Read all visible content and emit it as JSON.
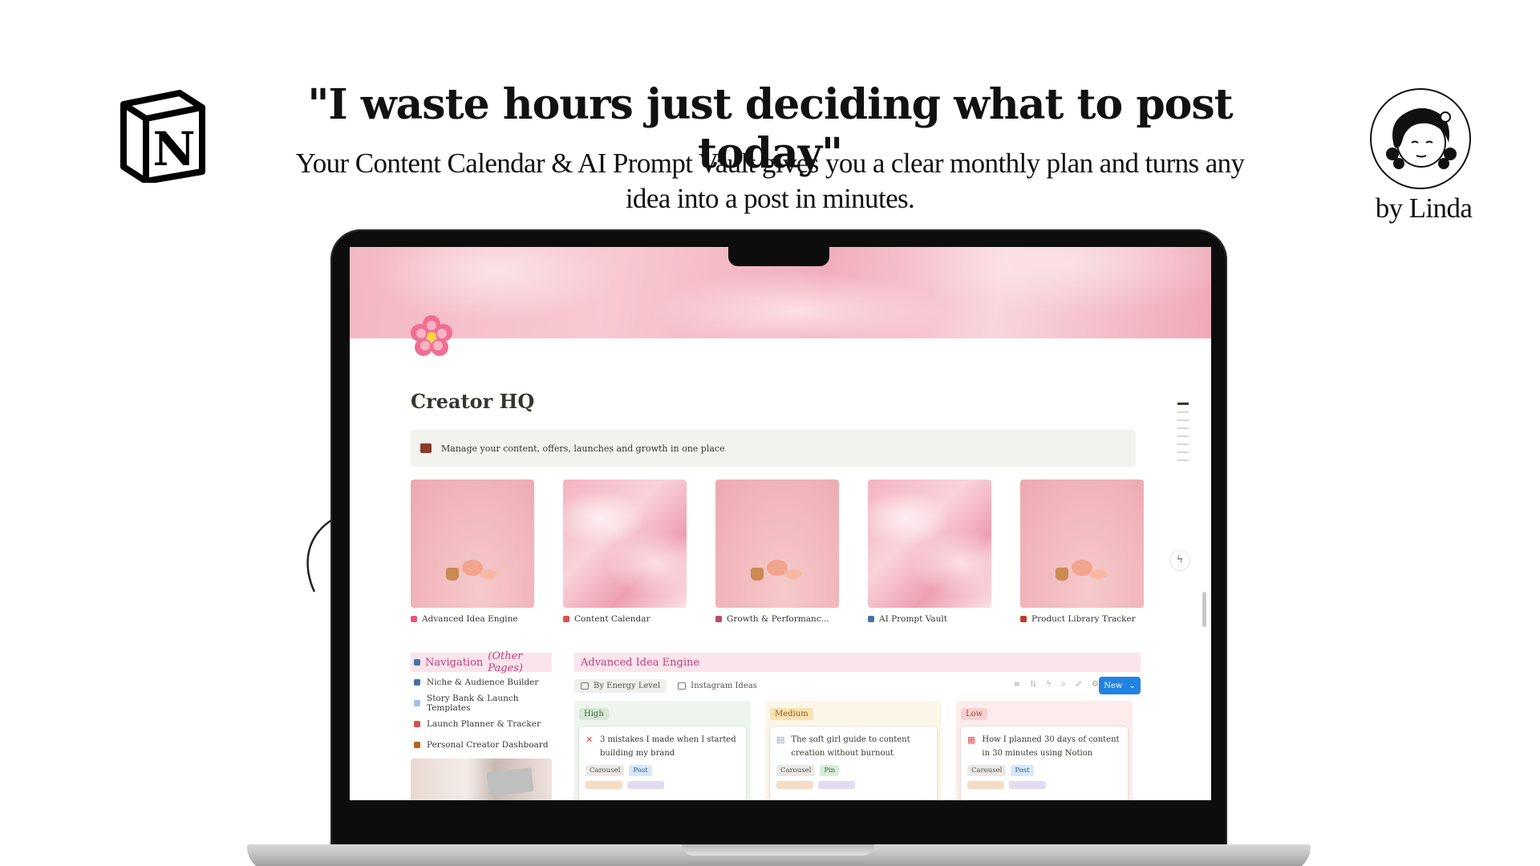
{
  "promo": {
    "headline": "\"I waste hours just deciding what to post today\"",
    "subline": "Your Content Calendar & AI Prompt Vault gives you a clear monthly plan and turns any idea into a post in minutes.",
    "byline": "by Linda"
  },
  "notion_page": {
    "title": "Creator HQ",
    "callout": "Manage your content, offers, launches and growth in one place",
    "gallery": [
      {
        "label": "Advanced Idea Engine",
        "icon_color": "#e8587a",
        "thumb": "still"
      },
      {
        "label": "Content Calendar",
        "icon_color": "#d9534f",
        "thumb": "silk"
      },
      {
        "label": "Growth & Performanc...",
        "icon_color": "#b94a6a",
        "thumb": "still"
      },
      {
        "label": "AI Prompt Vault",
        "icon_color": "#4a6fa5",
        "thumb": "silk"
      },
      {
        "label": "Product Library Tracker",
        "icon_color": "#c0392b",
        "thumb": "still"
      }
    ],
    "navigation": {
      "heading": "Navigation",
      "heading_sub": "(Other Pages)",
      "items": [
        {
          "label": "Niche & Audience Builder",
          "icon_color": "#4a6fa5"
        },
        {
          "label": "Story Bank & Launch Templates",
          "icon_color": "#9fc3e7"
        },
        {
          "label": "Launch Planner & Tracker",
          "icon_color": "#d9534f"
        },
        {
          "label": "Personal Creator Dashboard",
          "icon_color": "#b5651d"
        }
      ]
    },
    "board": {
      "heading": "Advanced Idea Engine",
      "views": [
        {
          "label": "By Energy Level",
          "active": true
        },
        {
          "label": "Instagram Ideas",
          "active": false
        }
      ],
      "new_button": "New",
      "columns": [
        {
          "tag": "High",
          "level": "high",
          "card": {
            "title": "3 mistakes I made when I started building my brand",
            "icon": "✕",
            "icon_color": "#e0443a",
            "chips": [
              {
                "text": "Carousel",
                "style": "gray"
              },
              {
                "text": "Post",
                "style": "blue"
              }
            ]
          }
        },
        {
          "tag": "Medium",
          "level": "medium",
          "card": {
            "title": "The soft girl guide to content creation without burnout",
            "icon": "▤",
            "icon_color": "#8fa3b8",
            "chips": [
              {
                "text": "Carousel",
                "style": "gray"
              },
              {
                "text": "Pin",
                "style": "green"
              }
            ]
          }
        },
        {
          "tag": "Low",
          "level": "low",
          "card": {
            "title": "How I planned 30 days of content in 30 minutes using Notion",
            "icon": "▦",
            "icon_color": "#d9534f",
            "chips": [
              {
                "text": "Carousel",
                "style": "gray"
              },
              {
                "text": "Post",
                "style": "blue"
              }
            ]
          }
        }
      ]
    }
  },
  "icons": {
    "brand_logo": "notion-logo-icon",
    "page_icon": "cherry-blossom-icon",
    "callout_icon": "briefcase-icon",
    "ai_button": "ai-sparkle-icon",
    "decoration": "curved-arrow-icon"
  }
}
